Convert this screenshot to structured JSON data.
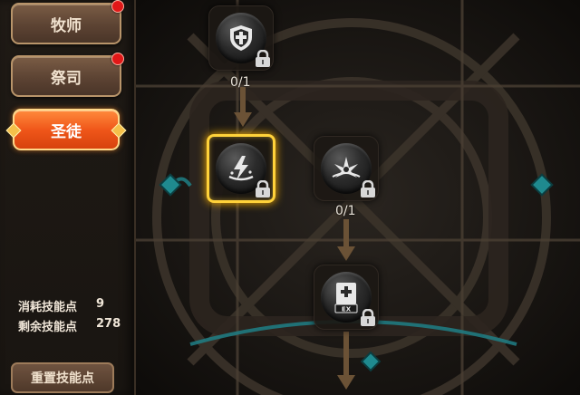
{
  "classes": [
    {
      "label": "牧师",
      "notify": true
    },
    {
      "label": "祭司",
      "notify": true
    },
    {
      "label": "圣徒",
      "selected": true
    }
  ],
  "stats": {
    "consumed_label": "消耗技能点",
    "consumed_value": "9",
    "remaining_label": "剩余技能点",
    "remaining_value": "278"
  },
  "reset_label": "重置技能点",
  "skills": {
    "shield": {
      "icon": "shield-cross-icon",
      "level": "0/1",
      "locked": true
    },
    "lightning": {
      "icon": "lightning-bolt-icon",
      "locked": true,
      "selected": true
    },
    "burst": {
      "icon": "holy-burst-icon",
      "level": "0/1",
      "locked": true
    },
    "ex": {
      "icon": "ex-book-icon",
      "badge": "EX",
      "locked": true
    }
  },
  "colors": {
    "accent": "#f0571a",
    "highlight": "#ffd23a",
    "teal": "#1f7f86"
  }
}
